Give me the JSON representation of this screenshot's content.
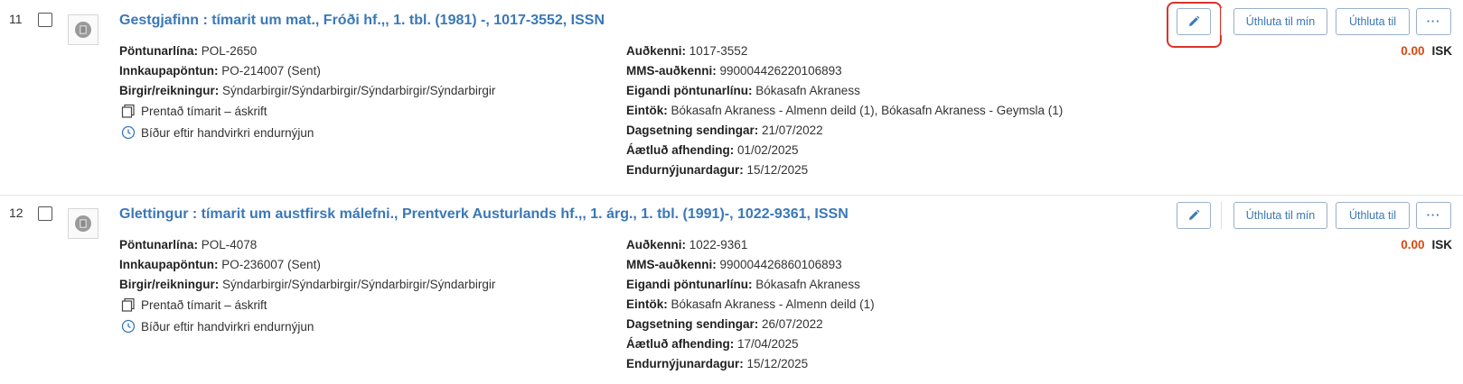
{
  "rows": [
    {
      "index": "11",
      "title": "Gestgjafinn : tímarit um mat., Fróði hf.,, 1. tbl. (1981) -, 1017-3552, ISSN",
      "left": {
        "pol_label": "Pöntunarlína:",
        "pol_value": "POL-2650",
        "po_label": "Innkaupapöntun:",
        "po_value": "PO-214007 (Sent)",
        "vendor_label": "Birgir/reikningur:",
        "vendor_value": "Sýndarbirgir/Sýndarbirgir/Sýndarbirgir/Sýndarbirgir",
        "type_text": "Prentað tímarit – áskrift",
        "status_text": "Bíður eftir handvirkri endurnýjun"
      },
      "right": {
        "id_label": "Auðkenni:",
        "id_value": "1017-3552",
        "mms_label": "MMS-auðkenni:",
        "mms_value": "990004426220106893",
        "owner_label": "Eigandi pöntunarlínu:",
        "owner_value": "Bókasafn Akraness",
        "items_label": "Eintök:",
        "items_value": "Bókasafn Akraness - Almenn deild (1), Bókasafn Akraness - Geymsla (1)",
        "sent_label": "Dagsetning sendingar:",
        "sent_value": "21/07/2022",
        "expected_label": "Áætluð afhending:",
        "expected_value": "01/02/2025",
        "renewal_label": "Endurnýjunardagur:",
        "renewal_value": "15/12/2025"
      },
      "actions": {
        "edit_icon": "pencil-icon",
        "assign_me": "Úthluta til mín",
        "assign": "Úthluta til",
        "more": "···"
      },
      "price": {
        "amount": "0.00",
        "currency": "ISK"
      }
    },
    {
      "index": "12",
      "title": "Glettingur : tímarit um austfirsk málefni., Prentverk Austurlands hf.,, 1. árg., 1. tbl. (1991)-, 1022-9361, ISSN",
      "left": {
        "pol_label": "Pöntunarlína:",
        "pol_value": "POL-4078",
        "po_label": "Innkaupapöntun:",
        "po_value": "PO-236007 (Sent)",
        "vendor_label": "Birgir/reikningur:",
        "vendor_value": "Sýndarbirgir/Sýndarbirgir/Sýndarbirgir/Sýndarbirgir",
        "type_text": "Prentað tímarit – áskrift",
        "status_text": "Bíður eftir handvirkri endurnýjun"
      },
      "right": {
        "id_label": "Auðkenni:",
        "id_value": "1022-9361",
        "mms_label": "MMS-auðkenni:",
        "mms_value": "990004426860106893",
        "owner_label": "Eigandi pöntunarlínu:",
        "owner_value": "Bókasafn Akraness",
        "items_label": "Eintök:",
        "items_value": "Bókasafn Akraness - Almenn deild (1)",
        "sent_label": "Dagsetning sendingar:",
        "sent_value": "26/07/2022",
        "expected_label": "Áætluð afhending:",
        "expected_value": "17/04/2025",
        "renewal_label": "Endurnýjunardagur:",
        "renewal_value": "15/12/2025"
      },
      "actions": {
        "edit_icon": "pencil-icon",
        "assign_me": "Úthluta til mín",
        "assign": "Úthluta til",
        "more": "···"
      },
      "price": {
        "amount": "0.00",
        "currency": "ISK"
      }
    }
  ],
  "colors": {
    "link": "#3a78b8",
    "price": "#d9480f",
    "highlight": "#d9342b"
  }
}
